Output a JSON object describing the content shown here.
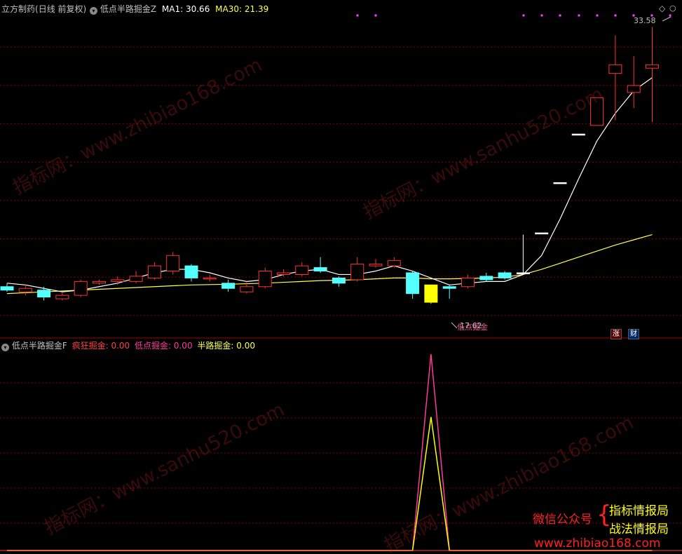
{
  "header": {
    "stock_name": "立方制药",
    "period": "(日线 前复权)",
    "indicator_top": "低点半路掘金Z",
    "ma1_label": "MA1:",
    "ma1_value": "30.66",
    "ma30_label": "MA30:",
    "ma30_value": "21.39"
  },
  "labels": {
    "high_price": "33.58",
    "low_price": "17.62",
    "signal_label": "低点掘金",
    "badge_zhang": "涨",
    "badge_cai": "财"
  },
  "sub_panel": {
    "indicator_name": "低点半路掘金F",
    "s1_label": "疯狂掘金:",
    "s1_value": "0.00",
    "s2_label": "低点掘金:",
    "s2_value": "0.00",
    "s3_label": "半路掘金:",
    "s3_value": "0.00"
  },
  "promo": {
    "wechat": "微信公众号",
    "name1": "指标情报局",
    "name2": "战法情报局",
    "url": "www.zhibiao168.com"
  },
  "watermarks": {
    "w1": "指标网：www.zhibiao168.com",
    "w2": "指标网：www.sanhu520.com"
  },
  "colors": {
    "up": "#ff3232",
    "down": "#54ffff",
    "ma1": "#ffffff",
    "ma30": "#ffff50",
    "grid": "#8b0000",
    "signal_yellow": "#ffff00"
  },
  "chart_data": {
    "type": "candlestick",
    "candles": [
      {
        "o": 18.6,
        "c": 18.4,
        "h": 18.8,
        "l": 18.3
      },
      {
        "o": 18.3,
        "c": 18.5,
        "h": 18.7,
        "l": 18.1
      },
      {
        "o": 18.4,
        "c": 18.0,
        "h": 18.6,
        "l": 17.8
      },
      {
        "o": 17.9,
        "c": 18.1,
        "h": 18.3,
        "l": 17.8
      },
      {
        "o": 18.1,
        "c": 18.9,
        "h": 19.0,
        "l": 18.0
      },
      {
        "o": 18.8,
        "c": 18.9,
        "h": 19.0,
        "l": 18.7
      },
      {
        "o": 18.9,
        "c": 19.0,
        "h": 19.2,
        "l": 18.7
      },
      {
        "o": 18.9,
        "c": 19.2,
        "h": 19.5,
        "l": 18.8
      },
      {
        "o": 19.1,
        "c": 19.8,
        "h": 20.0,
        "l": 19.0
      },
      {
        "o": 19.5,
        "c": 20.4,
        "h": 20.6,
        "l": 19.3
      },
      {
        "o": 19.8,
        "c": 19.1,
        "h": 19.9,
        "l": 18.9
      },
      {
        "o": 19.1,
        "c": 19.1,
        "h": 19.3,
        "l": 18.9
      },
      {
        "o": 18.8,
        "c": 18.5,
        "h": 19.0,
        "l": 18.3
      },
      {
        "o": 18.3,
        "c": 18.6,
        "h": 18.9,
        "l": 18.2
      },
      {
        "o": 18.6,
        "c": 19.5,
        "h": 19.7,
        "l": 18.5
      },
      {
        "o": 19.3,
        "c": 19.4,
        "h": 19.6,
        "l": 19.2
      },
      {
        "o": 19.3,
        "c": 19.8,
        "h": 20.0,
        "l": 19.2
      },
      {
        "o": 19.7,
        "c": 19.5,
        "h": 20.3,
        "l": 19.4
      },
      {
        "o": 19.1,
        "c": 18.8,
        "h": 19.2,
        "l": 18.6
      },
      {
        "o": 19.0,
        "c": 19.9,
        "h": 20.3,
        "l": 18.9
      },
      {
        "o": 19.8,
        "c": 19.9,
        "h": 20.2,
        "l": 19.7
      },
      {
        "o": 19.8,
        "c": 20.1,
        "h": 20.3,
        "l": 19.7
      },
      {
        "o": 19.4,
        "c": 18.2,
        "h": 19.5,
        "l": 17.9
      },
      {
        "o": 18.7,
        "c": 17.7,
        "h": 18.7,
        "l": 17.62
      },
      {
        "o": 18.6,
        "c": 18.5,
        "h": 18.7,
        "l": 17.9
      },
      {
        "o": 18.6,
        "c": 19.1,
        "h": 19.3,
        "l": 18.5
      },
      {
        "o": 19.2,
        "c": 19.0,
        "h": 19.4,
        "l": 18.9
      },
      {
        "o": 19.4,
        "c": 19.1,
        "h": 19.5,
        "l": 19.0
      },
      {
        "o": 19.4,
        "c": 19.4,
        "h": 21.6,
        "l": 19.4
      },
      {
        "o": 21.7,
        "c": 21.7,
        "h": 21.7,
        "l": 21.7
      },
      {
        "o": 24.6,
        "c": 24.6,
        "h": 24.6,
        "l": 24.6
      },
      {
        "o": 27.4,
        "c": 27.4,
        "h": 27.4,
        "l": 27.4
      },
      {
        "o": 27.9,
        "c": 29.5,
        "h": 29.5,
        "l": 27.9
      },
      {
        "o": 30.9,
        "c": 31.4,
        "h": 33.1,
        "l": 28.2
      },
      {
        "o": 29.8,
        "c": 30.2,
        "h": 31.9,
        "l": 28.9
      },
      {
        "o": 31.2,
        "c": 31.4,
        "h": 33.58,
        "l": 28.1
      }
    ],
    "ma1": [
      18.8,
      18.7,
      18.5,
      18.3,
      18.4,
      18.6,
      18.8,
      19.1,
      19.4,
      19.6,
      19.6,
      19.4,
      19.1,
      18.9,
      19.0,
      19.3,
      19.5,
      19.6,
      19.3,
      19.3,
      19.5,
      19.8,
      19.5,
      19.1,
      18.7,
      18.8,
      18.9,
      18.9,
      19.3,
      20.4,
      22.5,
      24.8,
      27.0,
      28.6,
      29.9,
      30.66
    ],
    "ma30": [
      18.2,
      18.25,
      18.3,
      18.35,
      18.4,
      18.45,
      18.5,
      18.55,
      18.6,
      18.65,
      18.7,
      18.72,
      18.74,
      18.77,
      18.8,
      18.85,
      18.9,
      18.95,
      18.97,
      19.0,
      19.05,
      19.1,
      19.1,
      19.05,
      19.05,
      19.07,
      19.1,
      19.15,
      19.3,
      19.6,
      19.95,
      20.3,
      20.65,
      21.0,
      21.3,
      21.6
    ],
    "signal": [
      0,
      0,
      0,
      0,
      0,
      0,
      0,
      0,
      0,
      0,
      0,
      0,
      0,
      0,
      0,
      0,
      0,
      0,
      0,
      0,
      0,
      0,
      0,
      100,
      0,
      0,
      0,
      0,
      0,
      0,
      0,
      0,
      0,
      0,
      0,
      0
    ],
    "signal2": [
      0,
      0,
      0,
      0,
      0,
      0,
      0,
      0,
      0,
      0,
      0,
      0,
      0,
      0,
      0,
      0,
      0,
      0,
      0,
      0,
      0,
      0,
      0,
      68,
      0,
      0,
      0,
      0,
      0,
      0,
      0,
      0,
      0,
      0,
      0,
      0
    ],
    "highlight_index": 23
  }
}
